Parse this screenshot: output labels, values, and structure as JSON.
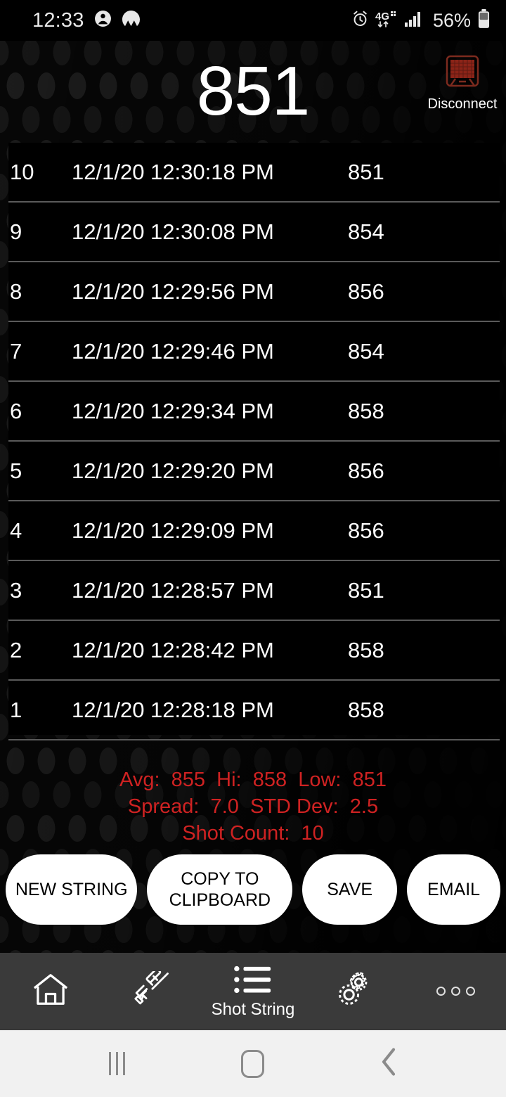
{
  "status_bar": {
    "time": "12:33",
    "battery_percent": "56%",
    "network": "4G+",
    "left_icons": [
      "contact-icon",
      "vpn-icon"
    ],
    "right_icons": [
      "alarm-icon",
      "network-4g-icon",
      "signal-bars-icon",
      "battery-icon"
    ]
  },
  "header": {
    "current_value": "851",
    "connection": {
      "label": "Disconnect",
      "icon": "chronograph-device-icon",
      "icon_color": "#8c2418"
    }
  },
  "shot_list": {
    "rows": [
      {
        "index": "10",
        "timestamp": "12/1/20 12:30:18 PM",
        "value": "851"
      },
      {
        "index": "9",
        "timestamp": "12/1/20 12:30:08 PM",
        "value": "854"
      },
      {
        "index": "8",
        "timestamp": "12/1/20 12:29:56 PM",
        "value": "856"
      },
      {
        "index": "7",
        "timestamp": "12/1/20 12:29:46 PM",
        "value": "854"
      },
      {
        "index": "6",
        "timestamp": "12/1/20 12:29:34 PM",
        "value": "858"
      },
      {
        "index": "5",
        "timestamp": "12/1/20 12:29:20 PM",
        "value": "856"
      },
      {
        "index": "4",
        "timestamp": "12/1/20 12:29:09 PM",
        "value": "856"
      },
      {
        "index": "3",
        "timestamp": "12/1/20 12:28:57 PM",
        "value": "851"
      },
      {
        "index": "2",
        "timestamp": "12/1/20 12:28:42 PM",
        "value": "858"
      },
      {
        "index": "1",
        "timestamp": "12/1/20 12:28:18 PM",
        "value": "858"
      }
    ]
  },
  "stats": {
    "color": "#cf2222",
    "line1": "Avg:  855  Hi:  858  Low:  851",
    "line2": "Spread:  7.0  STD Dev:  2.5",
    "line3": "Shot Count:  10",
    "avg": "855",
    "hi": "858",
    "low": "851",
    "spread": "7.0",
    "std_dev": "2.5",
    "shot_count": "10"
  },
  "actions": [
    {
      "label": "NEW STRING",
      "name": "new-string-button"
    },
    {
      "label": "COPY TO CLIPBOARD",
      "name": "copy-to-clipboard-button"
    },
    {
      "label": "SAVE",
      "name": "save-button"
    },
    {
      "label": "EMAIL",
      "name": "email-button"
    }
  ],
  "app_nav": {
    "items": [
      {
        "label": "",
        "icon": "home-icon",
        "name": "nav-home",
        "active": false
      },
      {
        "label": "",
        "icon": "rifle-icon",
        "name": "nav-rifle",
        "active": false
      },
      {
        "label": "Shot String",
        "icon": "list-icon",
        "name": "nav-shot-string",
        "active": true
      },
      {
        "label": "",
        "icon": "gears-icon",
        "name": "nav-settings",
        "active": false
      },
      {
        "label": "",
        "icon": "overflow-dots-icon",
        "name": "nav-more",
        "active": false
      }
    ]
  },
  "system_nav": {
    "recents": "recents-icon",
    "home": "home-button-icon",
    "back": "back-icon"
  }
}
